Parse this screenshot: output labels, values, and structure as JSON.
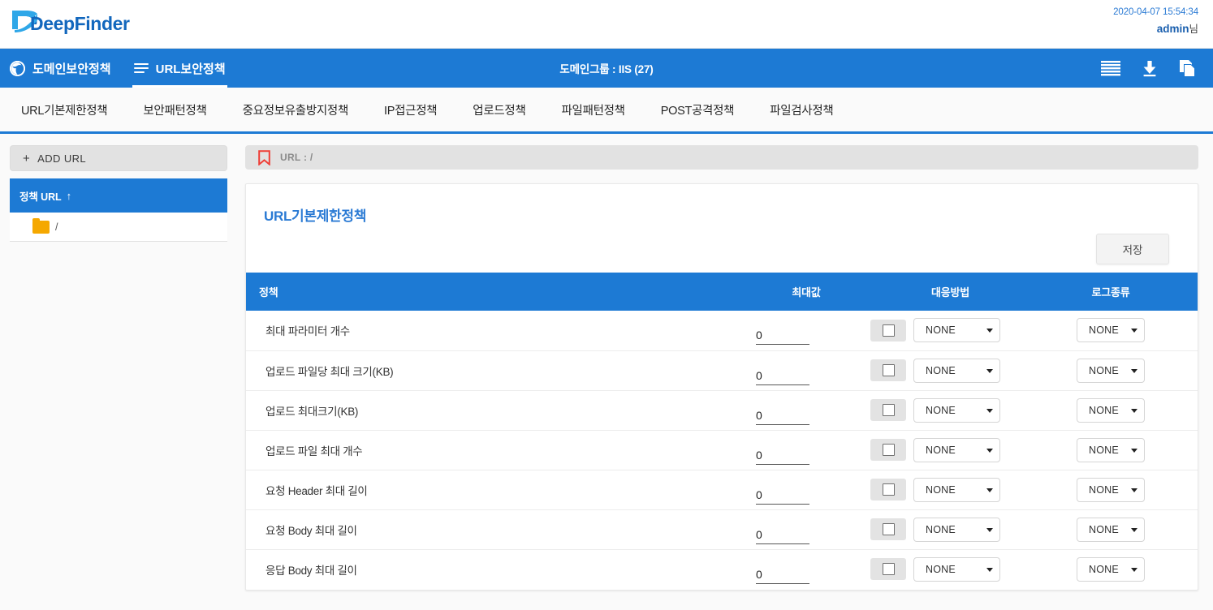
{
  "topbar": {
    "logo_text_a": "Deep",
    "logo_text_b": "Finder",
    "timestamp": "2020-04-07 15:54:34",
    "user": "admin",
    "user_honorific": "님"
  },
  "bluenav": {
    "items": [
      {
        "label": "도메인보안정책",
        "icon": "globe-icon",
        "active": false
      },
      {
        "label": "URL보안정책",
        "icon": "list-icon",
        "active": true
      }
    ],
    "center_label": "도메인그룹 : IIS (27)",
    "actions": [
      {
        "name": "list-view-icon"
      },
      {
        "name": "download-icon"
      },
      {
        "name": "copy-icon"
      }
    ]
  },
  "tabs": [
    {
      "label": "URL기본제한정책",
      "active": true
    },
    {
      "label": "보안패턴정책",
      "active": false
    },
    {
      "label": "중요정보유출방지정책",
      "active": false
    },
    {
      "label": "IP접근정책",
      "active": false
    },
    {
      "label": "업로드정책",
      "active": false
    },
    {
      "label": "파일패턴정책",
      "active": false
    },
    {
      "label": "POST공격정책",
      "active": false
    },
    {
      "label": "파일검사정책",
      "active": false
    }
  ],
  "sidebar": {
    "add_url_label": "ADD URL",
    "add_url_plus": "+",
    "tree_header": "정책 URL",
    "tree_header_arrow": "↑",
    "items": [
      {
        "label": "/",
        "icon": "folder-icon"
      }
    ]
  },
  "main": {
    "urlbar_label": "URL : /",
    "urlbar_icon": "bookmark-icon",
    "card_title": "URL기본제한정책",
    "save_label": "저장",
    "table": {
      "columns": {
        "policy": "정책",
        "max": "최대값",
        "response": "대응방법",
        "log": "로그종류"
      },
      "select_options": [
        "NONE"
      ],
      "rows": [
        {
          "policy": "최대 파라미터 개수",
          "max": "0",
          "checked": false,
          "response": "NONE",
          "log": "NONE"
        },
        {
          "policy": "업로드 파일당 최대 크기(KB)",
          "max": "0",
          "checked": false,
          "response": "NONE",
          "log": "NONE"
        },
        {
          "policy": "업로드 최대크기(KB)",
          "max": "0",
          "checked": false,
          "response": "NONE",
          "log": "NONE"
        },
        {
          "policy": "업로드 파일 최대 개수",
          "max": "0",
          "checked": false,
          "response": "NONE",
          "log": "NONE"
        },
        {
          "policy": "요청 Header 최대 길이",
          "max": "0",
          "checked": false,
          "response": "NONE",
          "log": "NONE"
        },
        {
          "policy": "요청 Body 최대 길이",
          "max": "0",
          "checked": false,
          "response": "NONE",
          "log": "NONE"
        },
        {
          "policy": "응답 Body 최대 길이",
          "max": "0",
          "checked": false,
          "response": "NONE",
          "log": "NONE"
        }
      ]
    }
  },
  "colors": {
    "brand_blue": "#1d7ad4",
    "link_blue": "#2a7ad4",
    "folder_orange": "#f5a800",
    "bookmark_red": "#ef3e36"
  }
}
